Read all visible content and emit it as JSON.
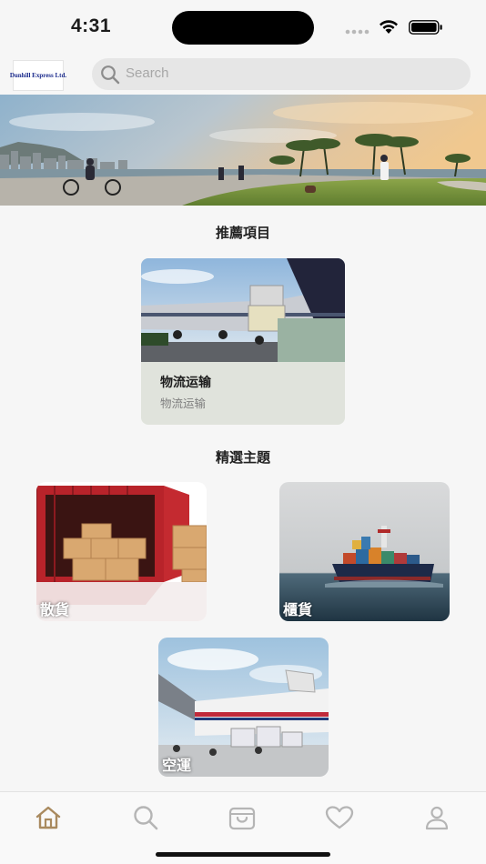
{
  "status_bar": {
    "time": "4:31"
  },
  "header": {
    "logo_text": "Dunhill Express Ltd.",
    "search_placeholder": "Search"
  },
  "recommended": {
    "section_title": "推薦項目",
    "card": {
      "title": "物流运输",
      "subtitle": "物流运输"
    }
  },
  "featured": {
    "section_title": "精選主題",
    "tiles": [
      {
        "label": "散貨"
      },
      {
        "label": "櫃貨"
      },
      {
        "label": "空運"
      }
    ]
  },
  "tab_bar": {
    "tabs": [
      {
        "icon": "home-icon",
        "active": true
      },
      {
        "icon": "search-icon",
        "active": false
      },
      {
        "icon": "bag-icon",
        "active": false
      },
      {
        "icon": "heart-icon",
        "active": false
      },
      {
        "icon": "profile-icon",
        "active": false
      }
    ],
    "active_color": "#a98a5f",
    "inactive_color": "#b5b5b5"
  }
}
